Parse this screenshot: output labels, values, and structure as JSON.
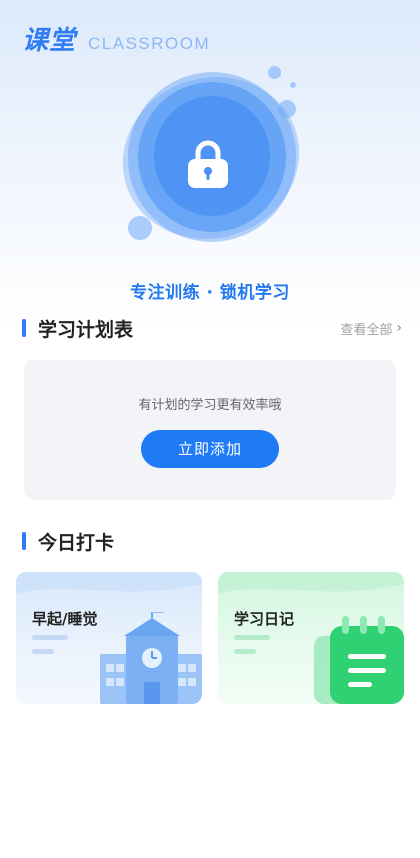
{
  "header": {
    "brand": "课堂",
    "brand_sub": "CLASSROOM"
  },
  "hero": {
    "slogan": "专注训练 · 锁机学习",
    "icon": "lock-icon"
  },
  "plan": {
    "title": "学习计划表",
    "view_all": "查看全部",
    "empty_hint": "有计划的学习更有效率哦",
    "add_button": "立即添加"
  },
  "checkin": {
    "title": "今日打卡",
    "cards": [
      {
        "label": "早起/睡觉",
        "icon": "school-building-icon"
      },
      {
        "label": "学习日记",
        "icon": "notebook-icon"
      }
    ]
  },
  "colors": {
    "accent": "#2f7df6",
    "button": "#1e7af5",
    "green": "#2fd173"
  }
}
